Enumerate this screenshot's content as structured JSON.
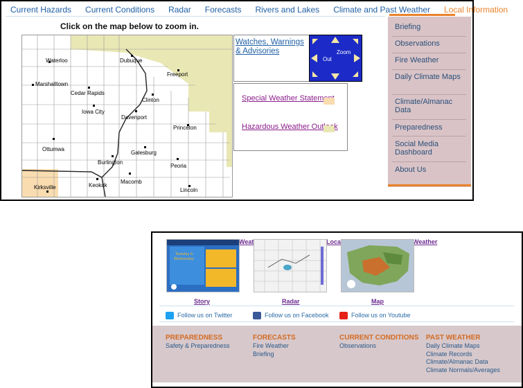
{
  "nav": {
    "items": [
      "Current Hazards",
      "Current Conditions",
      "Radar",
      "Forecasts",
      "Rivers and Lakes",
      "Climate and Past Weather",
      "Local Information"
    ],
    "active_index": 6
  },
  "map": {
    "instruction": "Click on the map below to zoom in.",
    "cities": [
      "Waterloo",
      "Dubuque",
      "Freeport",
      "Marshalltown",
      "Cedar Rapids",
      "Clinton",
      "Iowa City",
      "Davenport",
      "Princeton",
      "Ottumwa",
      "Galesburg",
      "Burlington",
      "Peoria",
      "Macomb",
      "Keokuk",
      "Kirksville",
      "Lincoln"
    ],
    "advisory_color": "#e9e7b4",
    "statement_color": "#f9dcb0"
  },
  "legend": {
    "watches_label": "Watches, Warnings & Advisories",
    "zoom_label": "Zoom",
    "out_label": "Out",
    "special_statement": "Special Weather Statement",
    "hazardous_outlook": "Hazardous Weather Outlook",
    "special_color": "#f9dcb0",
    "hazardous_color": "#e9e7b4"
  },
  "sidebar": {
    "items": [
      "Briefing",
      "Observations",
      "Fire Weather",
      "Daily Climate Maps",
      "Climate/Almanac Data",
      "Preparedness",
      "Social Media Dashboard",
      "About Us"
    ]
  },
  "thumbs": {
    "story": "Story",
    "radar": "Radar",
    "map": "Map",
    "cut1": "Weath",
    "cut2": "Loca",
    "cut3": "Weather"
  },
  "story_graphic": {
    "line1": "Tuesday &",
    "line2": "Wednesday"
  },
  "social": {
    "twitter": "Follow us on Twitter",
    "facebook": "Follow us on Facebook",
    "youtube": "Follow us on Youtube"
  },
  "footer": {
    "preparedness": {
      "heading": "PREPAREDNESS",
      "links": [
        "Safety & Preparedness"
      ]
    },
    "forecasts": {
      "heading": "FORECASTS",
      "links": [
        "Fire Weather",
        "Briefing"
      ]
    },
    "current": {
      "heading": "CURRENT CONDITIONS",
      "links": [
        "Observations"
      ]
    },
    "past": {
      "heading": "PAST WEATHER",
      "links": [
        "Daily Climate Maps",
        "Climate Records",
        "Climate/Almanac Data",
        "Climate Normals/Averages"
      ]
    }
  }
}
